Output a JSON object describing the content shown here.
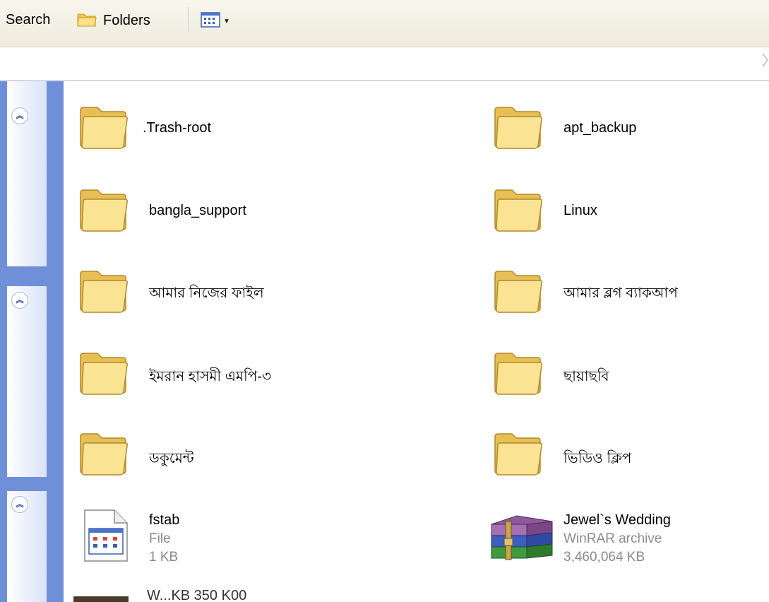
{
  "toolbar": {
    "search_label": "Search",
    "folders_label": "Folders"
  },
  "items": [
    {
      "name": ".Trash-root",
      "type": "folder"
    },
    {
      "name": "apt_backup",
      "type": "folder"
    },
    {
      "name": "bangla_support",
      "type": "folder"
    },
    {
      "name": "Linux",
      "type": "folder"
    },
    {
      "name": "আমার নিজের ফাইল",
      "type": "folder"
    },
    {
      "name": "আমার ব্লগ ব্যাকআপ",
      "type": "folder"
    },
    {
      "name": "ইমরান হাসমী এমপি-৩",
      "type": "folder"
    },
    {
      "name": "ছায়াছবি",
      "type": "folder"
    },
    {
      "name": "ডকুমেন্ট",
      "type": "folder"
    },
    {
      "name": "ভিডিও ক্লিপ",
      "type": "folder"
    },
    {
      "name": "fstab",
      "type": "file",
      "kind": "File",
      "size": "1 KB",
      "icon": "text-file-icon"
    },
    {
      "name": "Jewel`s Wedding",
      "type": "file",
      "kind": "WinRAR archive",
      "size": "3,460,064 KB",
      "icon": "winrar-archive-icon"
    }
  ],
  "partial_item": {
    "name": "W...KB 350 K00"
  },
  "colors": {
    "folder": "#f7d46b",
    "taskpane": "#6f8fd8",
    "toolbar": "#f3f0e4"
  }
}
